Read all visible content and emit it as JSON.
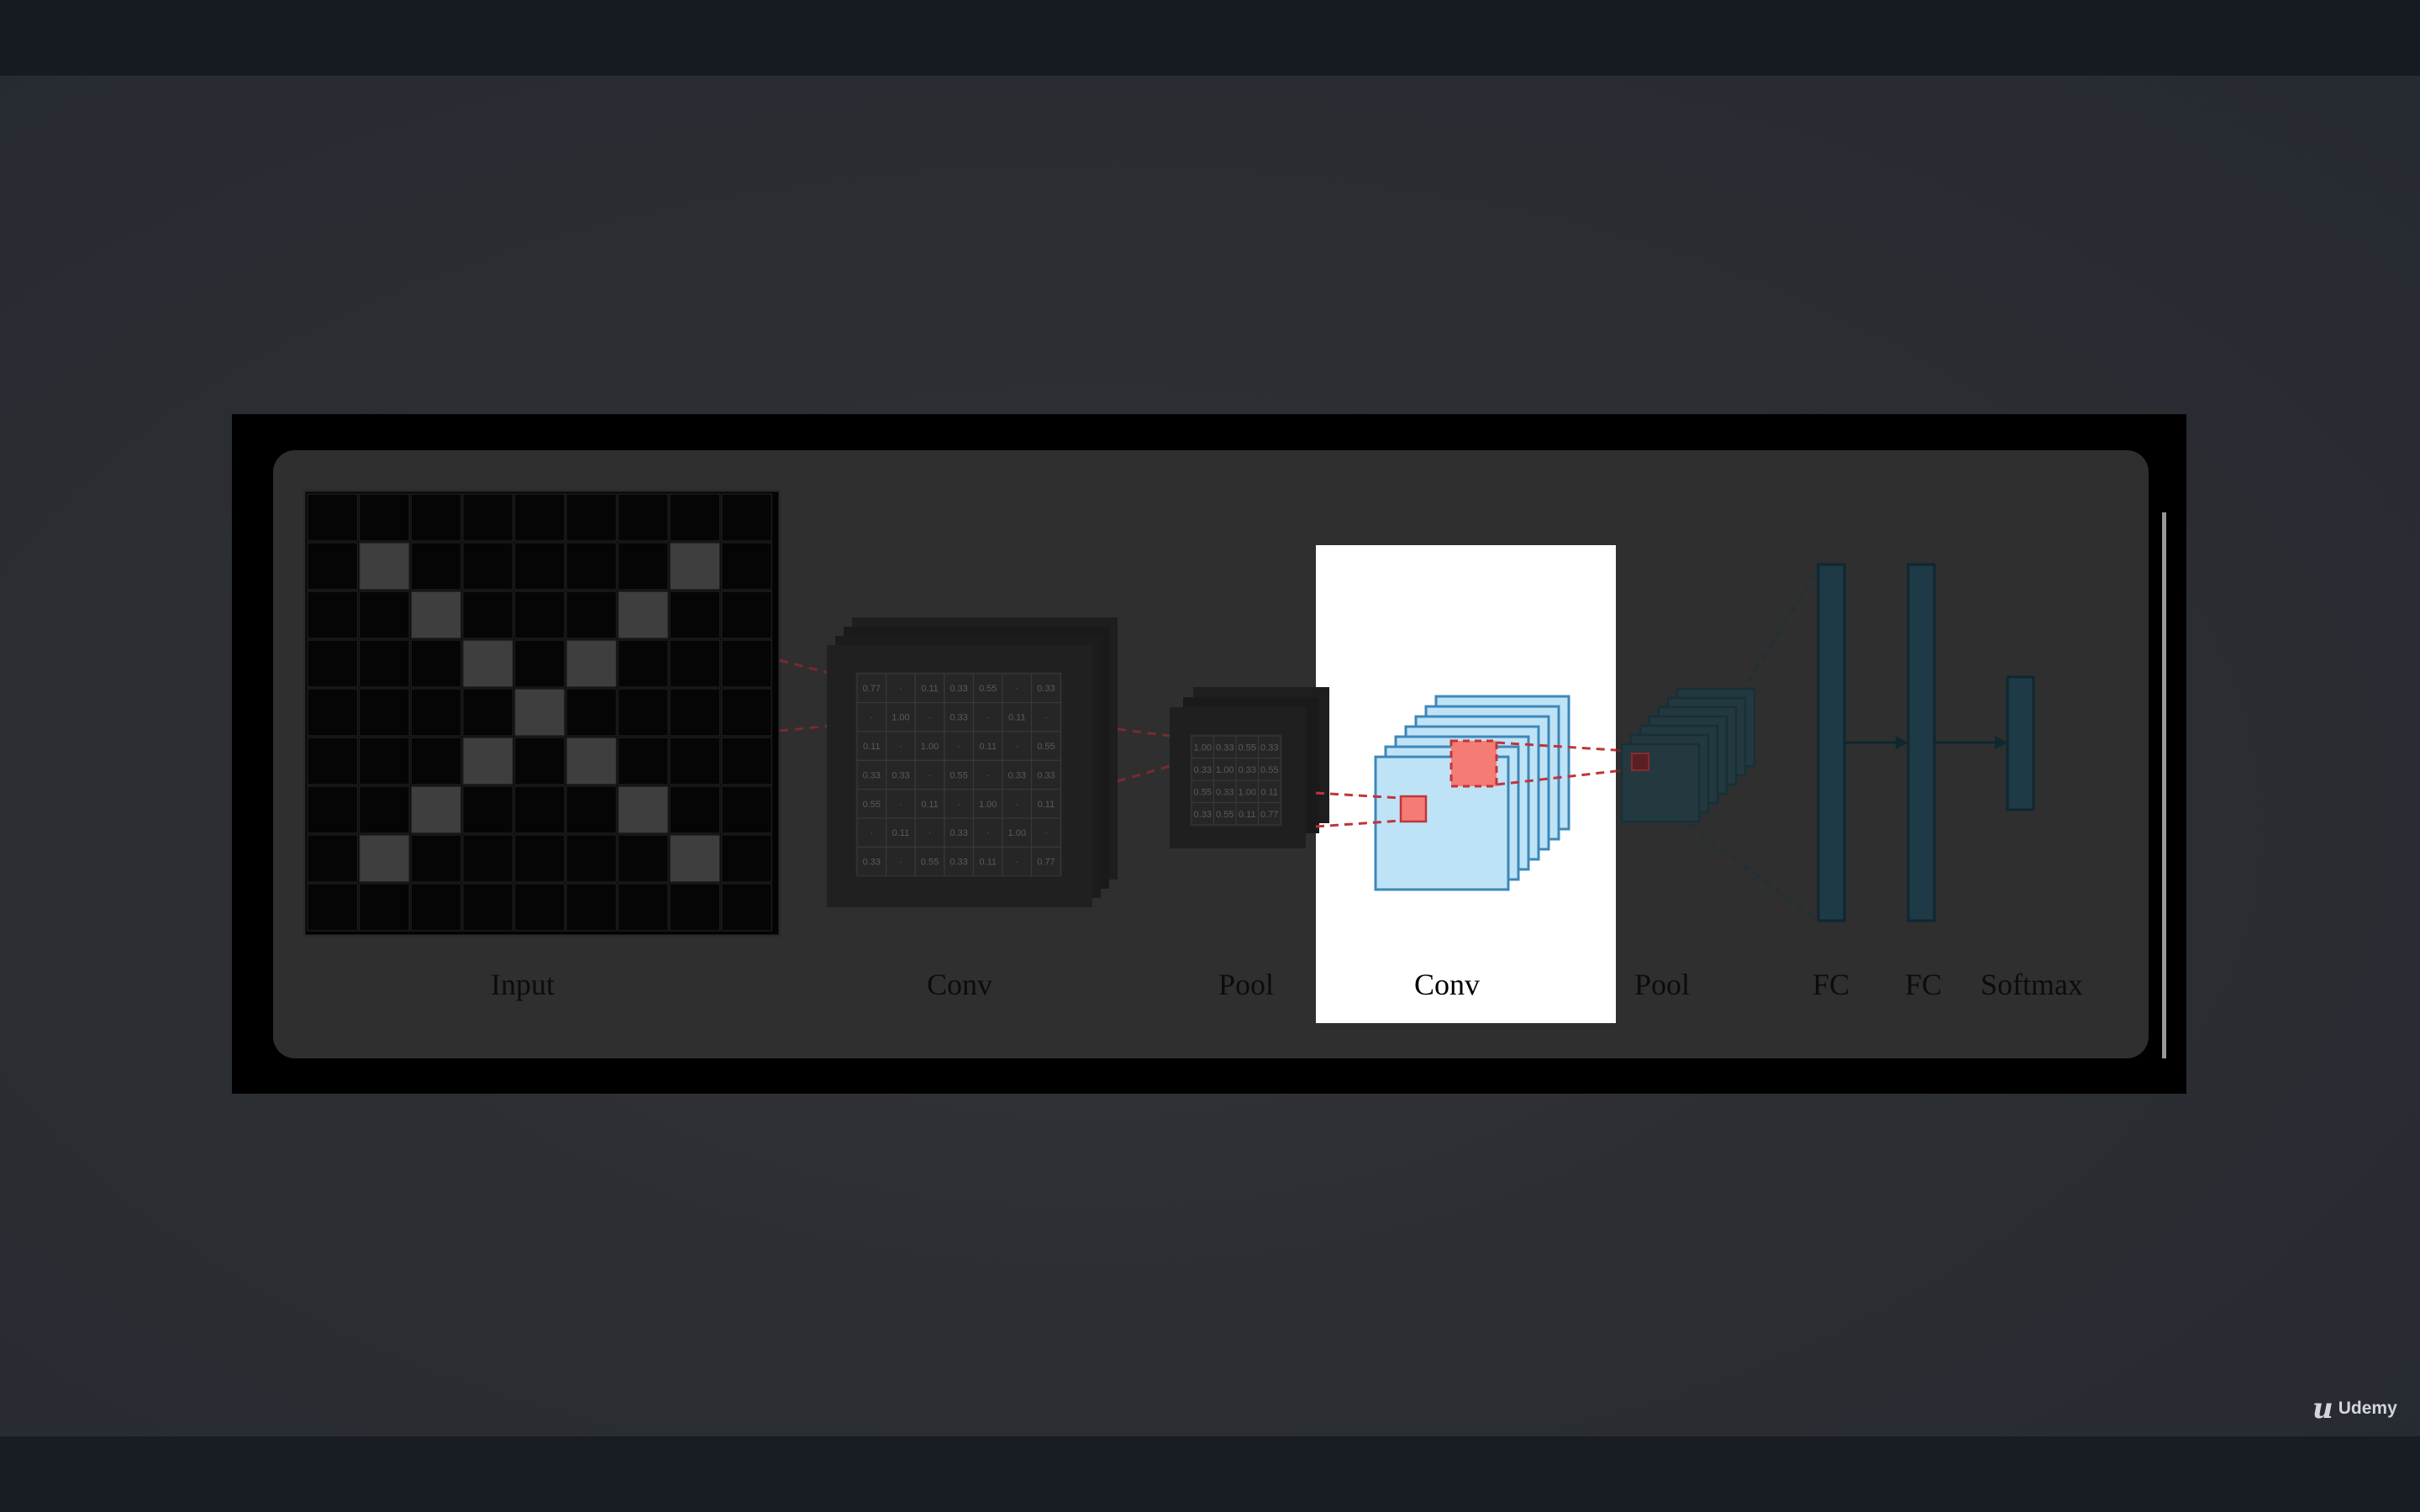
{
  "layers": [
    {
      "id": "input",
      "label": "Input"
    },
    {
      "id": "conv1",
      "label": "Conv"
    },
    {
      "id": "pool1",
      "label": "Pool"
    },
    {
      "id": "conv2",
      "label": "Conv"
    },
    {
      "id": "pool2",
      "label": "Pool"
    },
    {
      "id": "fc1",
      "label": "FC"
    },
    {
      "id": "fc2",
      "label": "FC"
    },
    {
      "id": "softmax",
      "label": "Softmax"
    }
  ],
  "highlighted_layer": "conv2",
  "input_grid": {
    "size": 9,
    "on_cells": [
      [
        1,
        1
      ],
      [
        1,
        7
      ],
      [
        2,
        2
      ],
      [
        2,
        6
      ],
      [
        3,
        3
      ],
      [
        3,
        5
      ],
      [
        4,
        4
      ],
      [
        5,
        3
      ],
      [
        5,
        5
      ],
      [
        6,
        2
      ],
      [
        6,
        6
      ],
      [
        7,
        1
      ],
      [
        7,
        7
      ]
    ]
  },
  "conv_map": [
    [
      "0.77",
      "",
      "0.11",
      "0.33",
      "0.55",
      "",
      "0.33"
    ],
    [
      "",
      "1.00",
      "",
      "0.33",
      "",
      "0.11",
      ""
    ],
    [
      "0.11",
      "",
      "1.00",
      "",
      "0.11",
      "",
      "0.55"
    ],
    [
      "0.33",
      "0.33",
      "",
      "0.55",
      "",
      "0.33",
      "0.33"
    ],
    [
      "0.55",
      "",
      "0.11",
      "",
      "1.00",
      "",
      "0.11"
    ],
    [
      "",
      "0.11",
      "",
      "0.33",
      "",
      "1.00",
      ""
    ],
    [
      "0.33",
      "",
      "0.55",
      "0.33",
      "0.11",
      "",
      "0.77"
    ]
  ],
  "pool_map": [
    [
      "1.00",
      "0.33",
      "0.55",
      "0.33"
    ],
    [
      "0.33",
      "1.00",
      "0.33",
      "0.55"
    ],
    [
      "0.55",
      "0.33",
      "1.00",
      "0.11"
    ],
    [
      "0.33",
      "0.55",
      "0.11",
      "0.77"
    ]
  ],
  "colors": {
    "conv_fill": "#bfe3f6",
    "conv_stroke": "#3d87b8",
    "receptive_fill": "#f47c74",
    "receptive_stroke": "#c0353a",
    "connector": "#c0353a",
    "fc_fill": "#1e3a46"
  },
  "watermark": {
    "logo": "u",
    "text": "Udemy"
  }
}
